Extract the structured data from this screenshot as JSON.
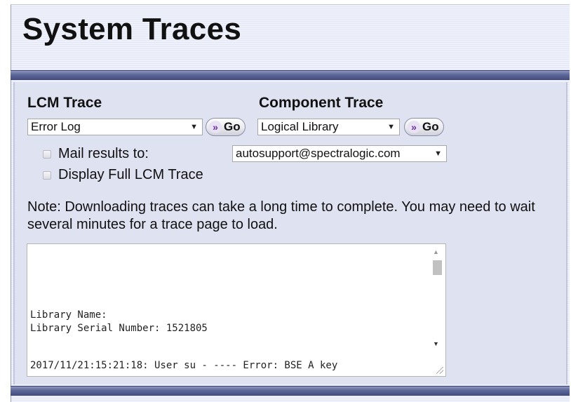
{
  "page": {
    "title": "System Traces"
  },
  "lcm_trace": {
    "heading": "LCM Trace",
    "selected": "Error Log",
    "go_label": "Go"
  },
  "component_trace": {
    "heading": "Component Trace",
    "selected": "Logical Library",
    "go_label": "Go"
  },
  "options": {
    "mail_results_label": "Mail results to:",
    "mail_results_checked": false,
    "mail_address": "autosupport@spectralogic.com",
    "full_trace_label": "Display Full LCM Trace",
    "full_trace_checked": false
  },
  "note": "Note: Downloading traces can take a long time to complete. You may need to wait several minutes for a trace page to load.",
  "trace_output": {
    "line_library_name": "Library Name:",
    "line_serial": "Library Serial Number: 1521805",
    "line_error": "2017/11/21:15:21:18: User su - ---- Error: BSE A key"
  },
  "icons": {
    "go": "double-chevron-right-icon",
    "select_arrow": "dropdown-arrow-icon"
  },
  "colors": {
    "header_bar": "#5d6899",
    "panel_background": "#dfe2f1",
    "go_icon": "#6a2ca0"
  }
}
